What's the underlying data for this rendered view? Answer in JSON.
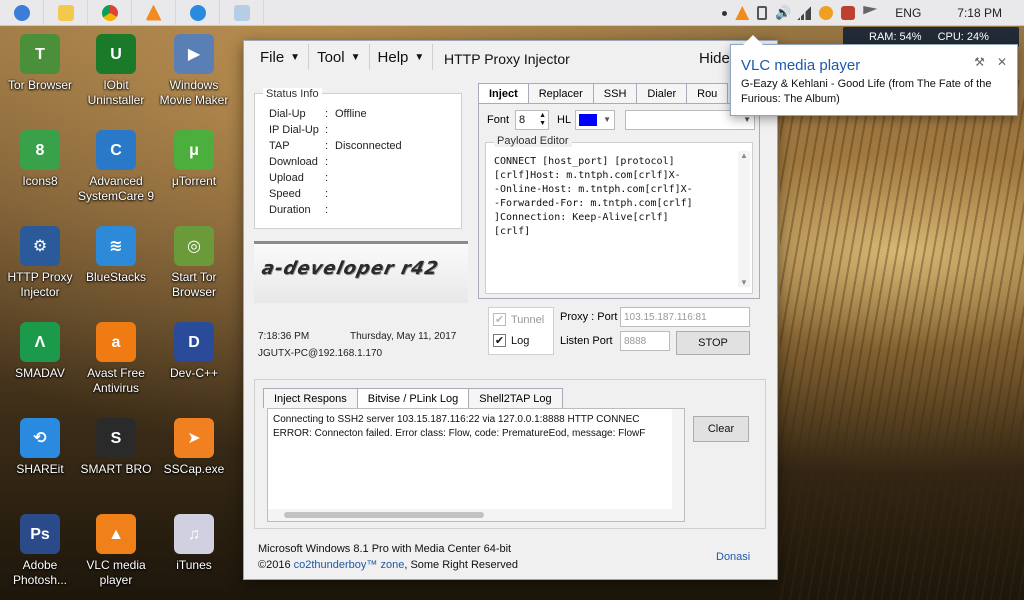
{
  "taskbar": {
    "time": "7:18 PM",
    "lang": "ENG",
    "pinned": [
      "ie-icon",
      "folder-icon",
      "chrome-icon",
      "vlc-icon",
      "browser-icon",
      "notepad-icon"
    ]
  },
  "meter": {
    "ram": "RAM: 54%",
    "cpu": "CPU: 24%"
  },
  "notification": {
    "title": "VLC media player",
    "body": "G-Eazy & Kehlani - Good Life (from The Fate of the Furious: The Album)"
  },
  "desktop_icons": [
    {
      "label": "Tor Browser",
      "color": "#4a8f3a",
      "glyph": "T"
    },
    {
      "label": "IObit Uninstaller",
      "color": "#1a7a2a",
      "glyph": "U"
    },
    {
      "label": "Windows Movie Maker",
      "color": "#5a7fb5",
      "glyph": "▶"
    },
    {
      "label": "Icons8",
      "color": "#39a14a",
      "glyph": "8"
    },
    {
      "label": "Advanced SystemCare 9",
      "color": "#2a79c9",
      "glyph": "C"
    },
    {
      "label": "μTorrent",
      "color": "#4cae3c",
      "glyph": "μ"
    },
    {
      "label": "HTTP Proxy Injector",
      "color": "#2a5a9a",
      "glyph": "⚙"
    },
    {
      "label": "BlueStacks",
      "color": "#2c8ad8",
      "glyph": "≋"
    },
    {
      "label": "Start Tor Browser",
      "color": "#6a9a3a",
      "glyph": "◎"
    },
    {
      "label": "SMADAV",
      "color": "#1a9a4a",
      "glyph": "Λ"
    },
    {
      "label": "Avast Free Antivirus",
      "color": "#f07b12",
      "glyph": "a"
    },
    {
      "label": "Dev-C++",
      "color": "#2a4a9a",
      "glyph": "D"
    },
    {
      "label": "SHAREit",
      "color": "#2a8ae0",
      "glyph": "⟲"
    },
    {
      "label": "SMART BRO",
      "color": "#2a2a2a",
      "glyph": "S"
    },
    {
      "label": "SSCap.exe",
      "color": "#f08020",
      "glyph": "➤"
    },
    {
      "label": "Adobe Photosh...",
      "color": "#2a4a8a",
      "glyph": "Ps"
    },
    {
      "label": "VLC media player",
      "color": "#f0801a",
      "glyph": "▲"
    },
    {
      "label": "iTunes",
      "color": "#d0d0e0",
      "glyph": "♫"
    }
  ],
  "window": {
    "menus": [
      "File",
      "Tool",
      "Help"
    ],
    "title": "HTTP Proxy Injector",
    "hide": "Hide",
    "status": {
      "legend": "Status Info",
      "rows": [
        {
          "k": "Dial-Up",
          "v": "Offline"
        },
        {
          "k": "IP Dial-Up",
          "v": ""
        },
        {
          "k": "TAP",
          "v": "Disconnected"
        },
        {
          "k": "Download",
          "v": ""
        },
        {
          "k": "Upload",
          "v": ""
        },
        {
          "k": "Speed",
          "v": ""
        },
        {
          "k": "Duration",
          "v": ""
        }
      ]
    },
    "logo": "a-developer r42",
    "time": "7:18:36 PM",
    "date": "Thursday, May 11, 2017",
    "host": "JGUTX-PC@192.168.1.170",
    "tabs": [
      "Inject",
      "Replacer",
      "SSH",
      "Dialer",
      "Rou"
    ],
    "font_label": "Font",
    "font_value": "8",
    "hl_label": "HL",
    "payload_legend": "Payload Editor",
    "payload_lines": [
      "CONNECT [host_port] [protocol]",
      "[crlf]Host: m.tntph.com[crlf]X-",
      "-Online-Host: m.tntph.com[crlf]X-",
      "-Forwarded-For: m.tntph.com[crlf]",
      "]Connection: Keep-Alive[crlf]",
      "[crlf]"
    ],
    "tunnel_label": "Tunnel",
    "log_label": "Log",
    "proxy_label": "Proxy : Port",
    "proxy_value": "103.15.187.116:81",
    "listen_label": "Listen Port",
    "listen_value": "8888",
    "stop_label": "STOP",
    "log_tabs": [
      "Inject Respons",
      "Bitvise / PLink Log",
      "Shell2TAP Log"
    ],
    "log_lines": [
      "Connecting to SSH2 server 103.15.187.116:22 via 127.0.0.1:8888 HTTP CONNEC",
      "ERROR: Connecton failed. Error class: Flow, code: PrematureEod, message: FlowF"
    ],
    "clear_label": "Clear",
    "footer_os": "Microsoft Windows 8.1 Pro with Media Center 64-bit",
    "footer_copyright_prefix": "©2016 ",
    "footer_author": "co2thunderboy™ zone",
    "footer_copyright_suffix": ", Some Right Reserved",
    "donasi": "Donasi"
  }
}
